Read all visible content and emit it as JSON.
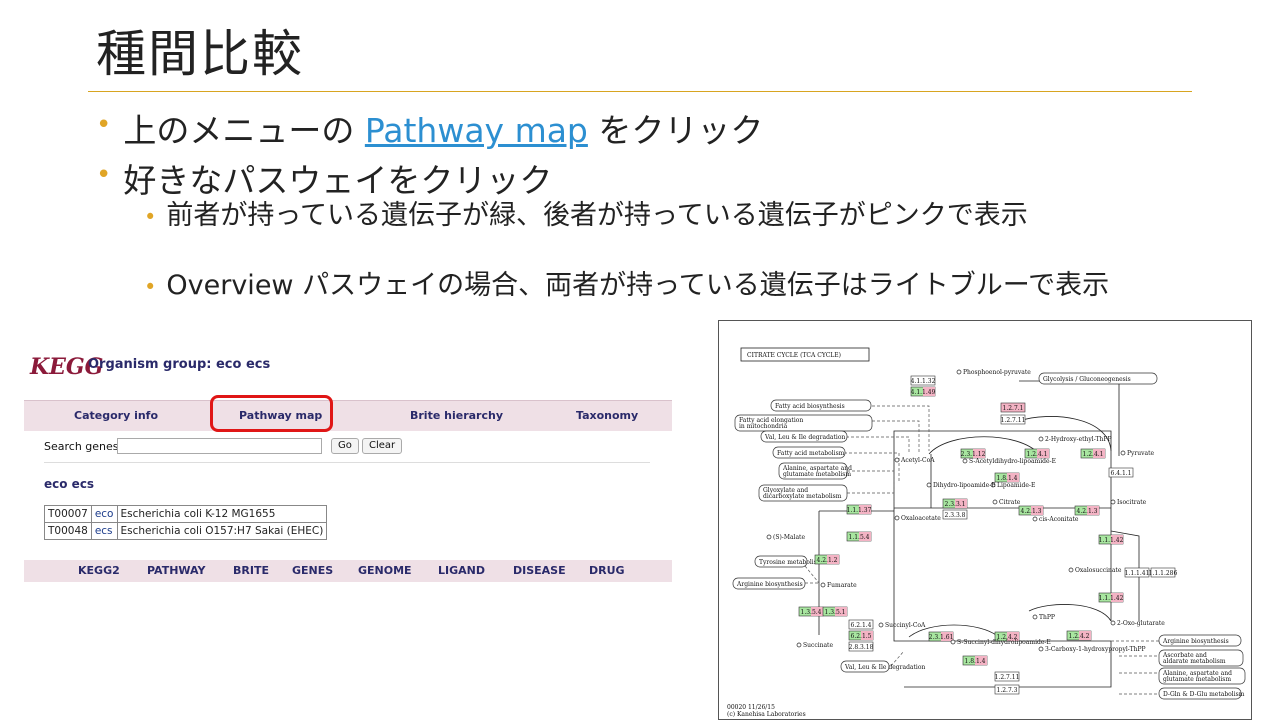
{
  "slide": {
    "title": "種間比較",
    "bullets": {
      "b1_before": "上のメニューの ",
      "b1_link": "Pathway map",
      "b1_after": " をクリック",
      "b2": "好きなパスウェイをクリック",
      "b2_1": "前者が持っている遺伝子が緑、後者が持っている遺伝子がピンクで表示",
      "b2_2": "Overview パスウェイの場合、両者が持っている遺伝子はライトブルーで表示"
    }
  },
  "colors": {
    "accent_rule": "#d8a520",
    "bullet": "#e0a526",
    "link": "#2c8fd1",
    "highlight": "#e01616",
    "green": "#a8e6a0",
    "pink": "#f3b3c4"
  },
  "kegg": {
    "logo": "KEGG",
    "group_title": "Organism group: eco ecs",
    "menu": [
      "Category info",
      "Pathway map",
      "Brite hierarchy",
      "Taxonomy"
    ],
    "search_label": "Search genes:",
    "search_value": "",
    "go_label": "Go",
    "clear_label": "Clear",
    "org_title": "eco ecs",
    "organisms": [
      {
        "id": "T00007",
        "code": "eco",
        "name": "Escherichia coli K-12 MG1655"
      },
      {
        "id": "T00048",
        "code": "ecs",
        "name": "Escherichia coli O157:H7 Sakai (EHEC)"
      }
    ],
    "footer": [
      "KEGG2",
      "PATHWAY",
      "BRITE",
      "GENES",
      "GENOME",
      "LIGAND",
      "DISEASE",
      "DRUG"
    ]
  },
  "map": {
    "title": "CITRATE CYCLE (TCA CYCLE)",
    "footer1": "00020 11/26/15",
    "footer2": "(c) Kanehisa Laboratories",
    "side_boxes": [
      "Fatty acid biosynthesis",
      "Fatty acid elongation in mitochondria",
      "Val, Leu & Ile degradation",
      "Fatty acid metabolism",
      "Alanine, aspartate and glutamate metabolism",
      "Glyoxylate and dicarboxylate metabolism",
      "Tyrosine metabolism",
      "Arginine biosynthesis",
      "Glycolysis / Gluconeogenesis",
      "Arginine biosynthesis",
      "Ascorbate and aldarate metabolism",
      "Alanine, aspartate and glutamate metabolism",
      "D-Gln & D-Glu metabolism",
      "Val, Leu & Ile degradation"
    ],
    "compounds": [
      "Phosphoenol-pyruvate",
      "Acetyl-CoA",
      "Pyruvate",
      "Oxaloacetate",
      "Citrate",
      "cis-Aconitate",
      "Isocitrate",
      "(S)-Malate",
      "Fumarate",
      "Oxalosuccinate",
      "2-Oxo-glutarate",
      "Succinyl-CoA",
      "Succinate",
      "ThPP",
      "Lipoamide-E",
      "Dihydro-lipoamide-E",
      "S-Acetyldihydro-lipoamide-E",
      "2-Hydroxy-ethyl-ThPP",
      "S-Succinyl-dihydrolipoamide-E",
      "3-Carboxy-1-hydroxypropyl-ThPP"
    ],
    "enzymes": [
      {
        "ec": "4.1.1.32",
        "state": "none"
      },
      {
        "ec": "4.1.1.49",
        "state": "both"
      },
      {
        "ec": "1.2.7.1",
        "state": "pink"
      },
      {
        "ec": "1.2.7.11",
        "state": "none"
      },
      {
        "ec": "2.3.1.12",
        "state": "both"
      },
      {
        "ec": "1.2.4.1",
        "state": "both"
      },
      {
        "ec": "1.2.4.1",
        "state": "both"
      },
      {
        "ec": "1.8.1.4",
        "state": "both"
      },
      {
        "ec": "6.4.1.1",
        "state": "none"
      },
      {
        "ec": "2.3.3.1",
        "state": "both"
      },
      {
        "ec": "2.3.3.8",
        "state": "none"
      },
      {
        "ec": "4.2.1.3",
        "state": "both"
      },
      {
        "ec": "4.2.1.3",
        "state": "both"
      },
      {
        "ec": "1.1.1.37",
        "state": "both"
      },
      {
        "ec": "1.1.5.4",
        "state": "both"
      },
      {
        "ec": "4.2.1.2",
        "state": "both"
      },
      {
        "ec": "1.1.1.42",
        "state": "both"
      },
      {
        "ec": "1.1.1.41",
        "state": "none"
      },
      {
        "ec": "1.1.1.286",
        "state": "none"
      },
      {
        "ec": "1.1.1.42",
        "state": "both"
      },
      {
        "ec": "1.3.5.4",
        "state": "both"
      },
      {
        "ec": "1.3.5.1",
        "state": "both"
      },
      {
        "ec": "6.2.1.4",
        "state": "none"
      },
      {
        "ec": "6.2.1.5",
        "state": "both"
      },
      {
        "ec": "2.8.3.18",
        "state": "none"
      },
      {
        "ec": "2.3.1.61",
        "state": "both"
      },
      {
        "ec": "1.2.4.2",
        "state": "both"
      },
      {
        "ec": "1.2.4.2",
        "state": "both"
      },
      {
        "ec": "1.8.1.4",
        "state": "both"
      },
      {
        "ec": "1.2.7.11",
        "state": "none"
      },
      {
        "ec": "1.2.7.3",
        "state": "none"
      }
    ]
  }
}
